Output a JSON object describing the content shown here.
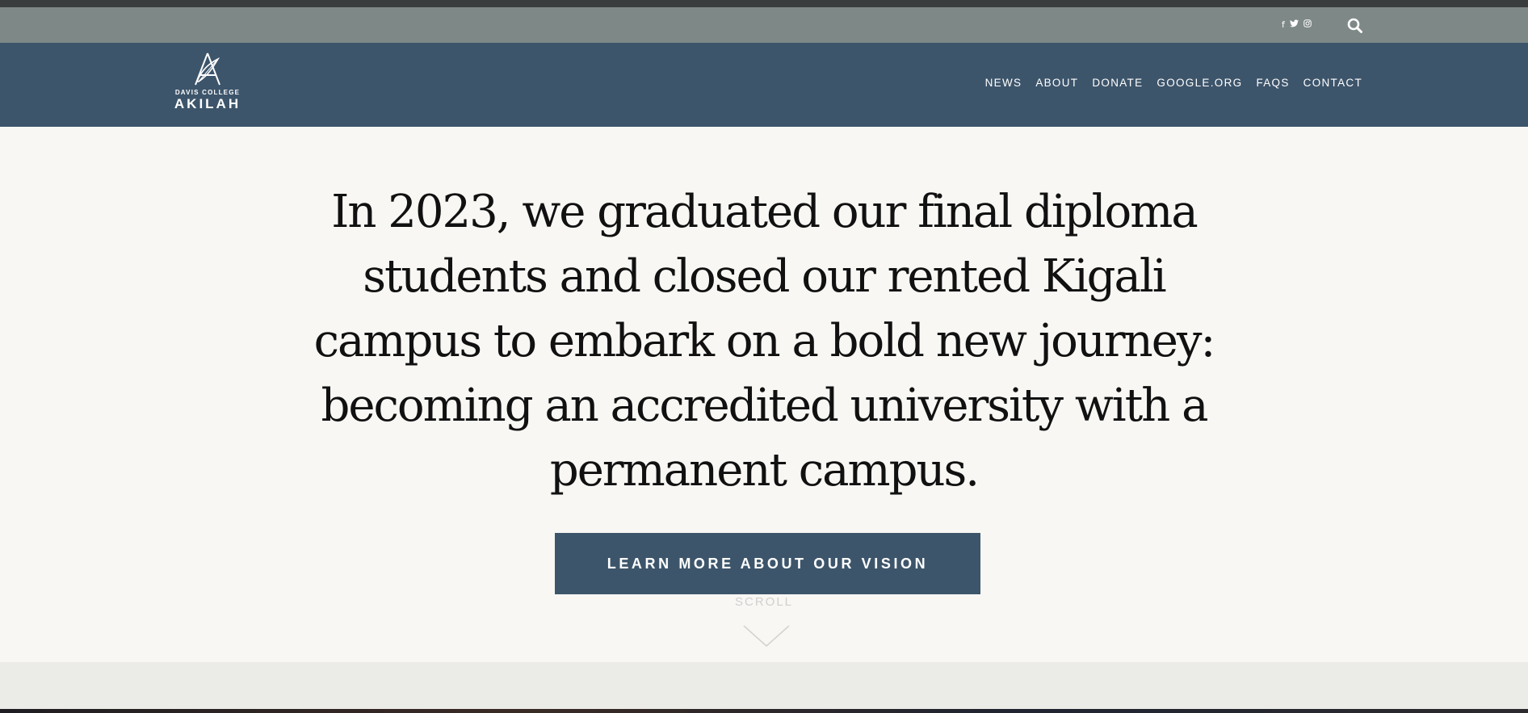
{
  "utility_bar": {
    "social": [
      {
        "icon": "facebook-icon",
        "glyph": "f"
      },
      {
        "icon": "twitter-icon",
        "glyph": "🐦"
      },
      {
        "icon": "instagram-icon",
        "glyph": "◎"
      }
    ],
    "search_icon": "search-icon"
  },
  "header": {
    "logo": {
      "subtitle": "DAVIS COLLEGE",
      "name": "AKILAH"
    },
    "nav": [
      {
        "label": "NEWS"
      },
      {
        "label": "ABOUT"
      },
      {
        "label": "DONATE"
      },
      {
        "label": "GOOGLE.ORG"
      },
      {
        "label": "FAQS"
      },
      {
        "label": "CONTACT"
      }
    ]
  },
  "hero": {
    "headline": "In 2023, we graduated our final diploma students and closed our rented Kigali campus to embark on a bold new journey: becoming an accredited university with a permanent campus.",
    "cta_label": "LEARN MORE ABOUT OUR VISION",
    "scroll_label": "SCROLL"
  },
  "colors": {
    "utility_bar": "#7e8987",
    "nav_bar": "#3d556b",
    "hero_bg": "#f8f7f4",
    "cta_bg": "#3d556b",
    "lower_band": "#ebebe7"
  }
}
